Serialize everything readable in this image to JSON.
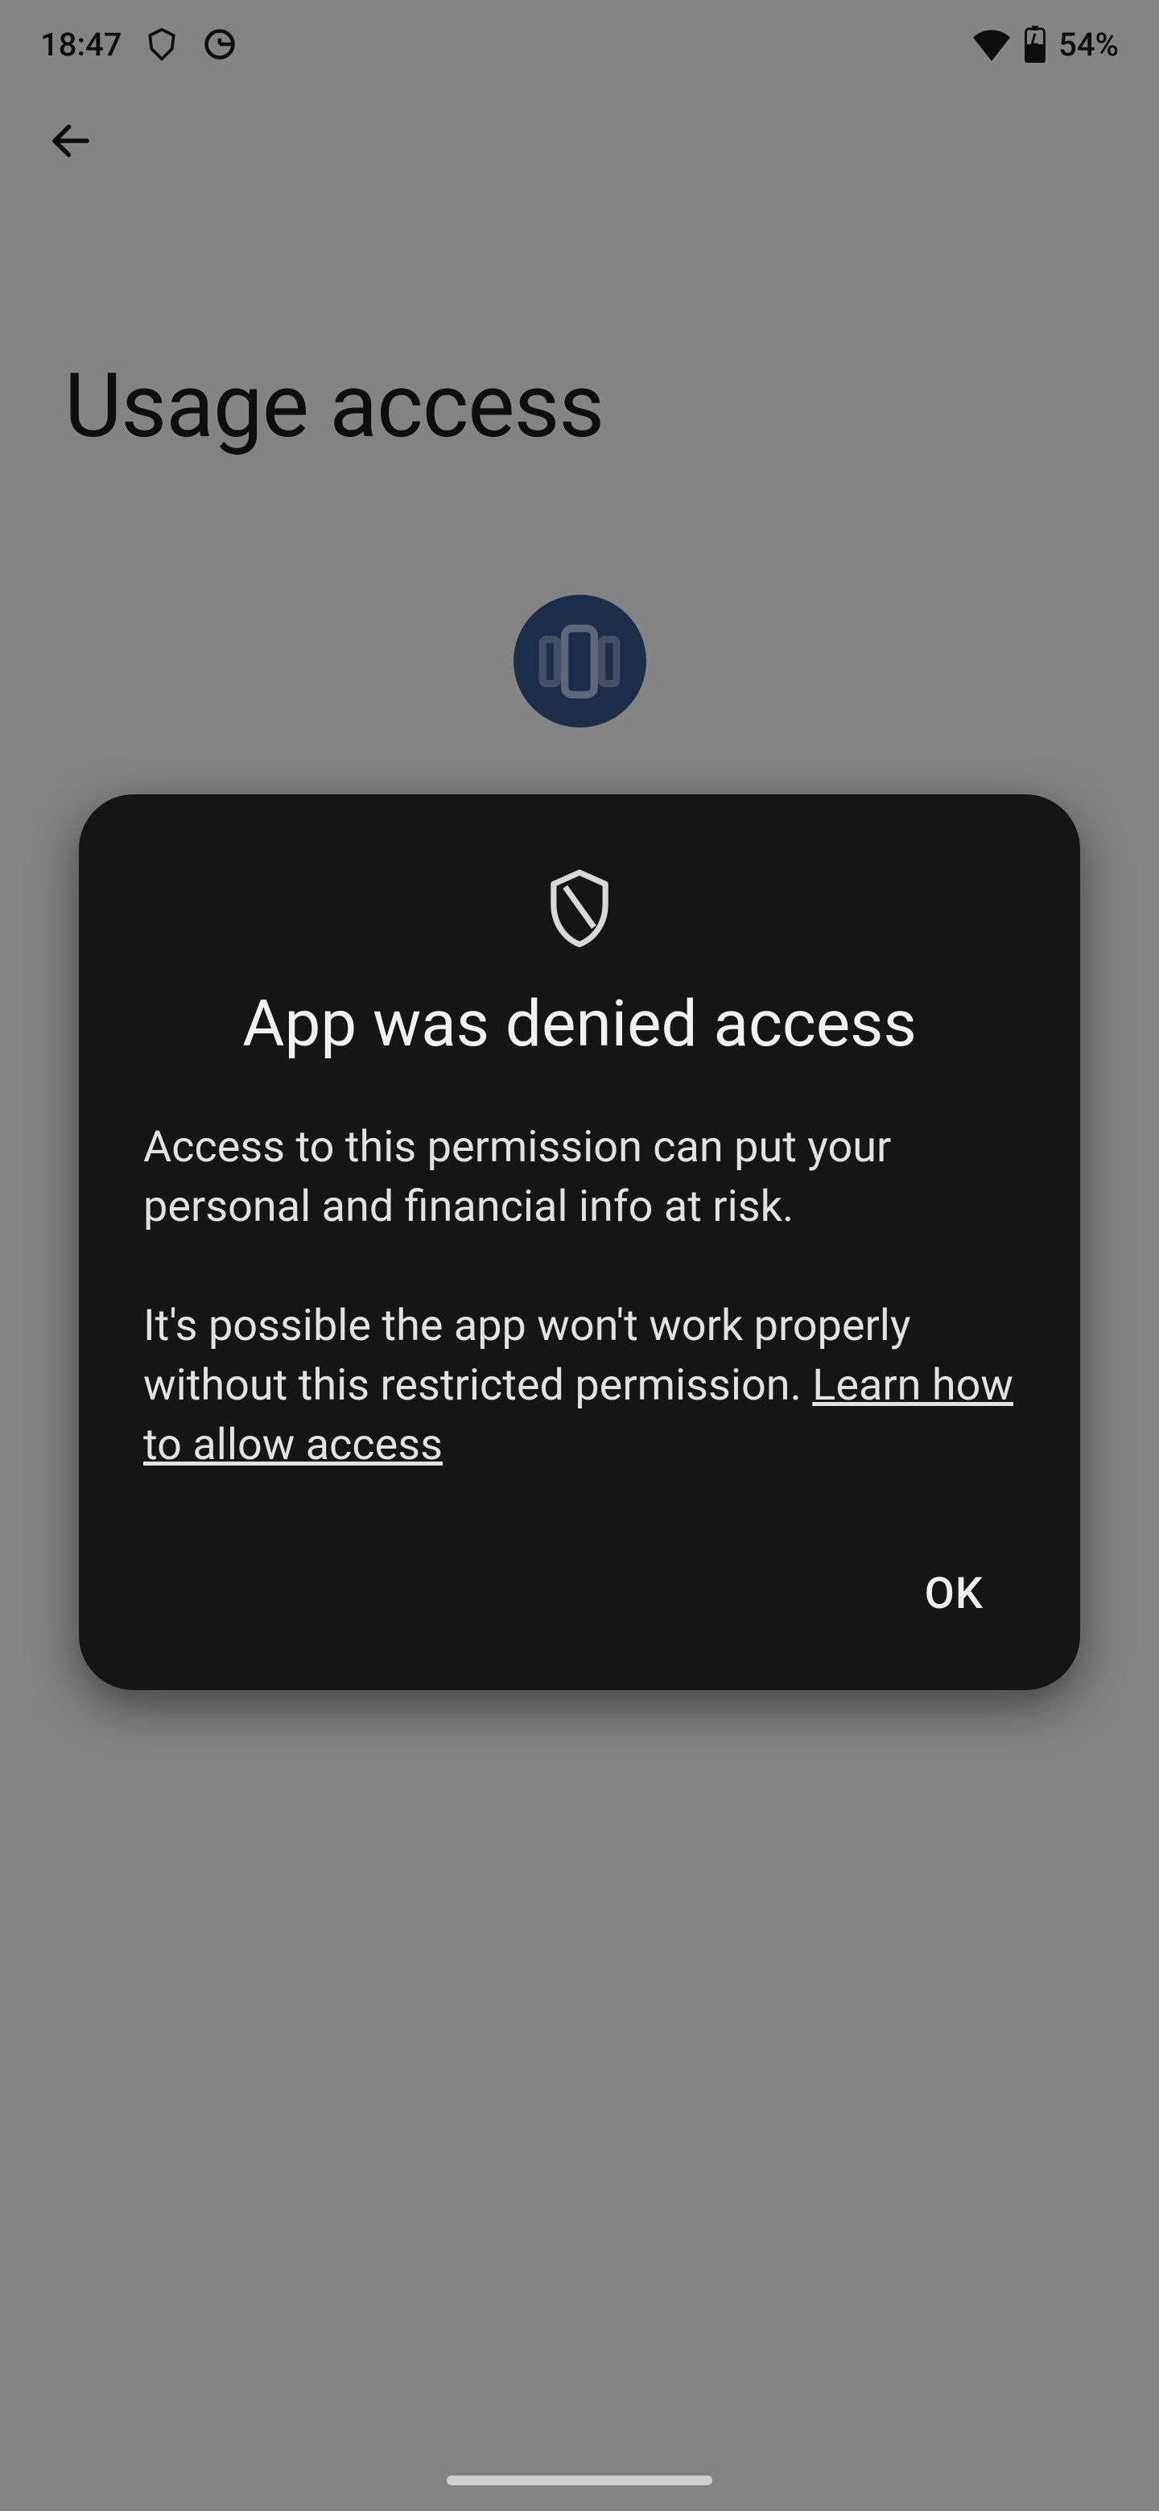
{
  "status_bar": {
    "time": "18:47",
    "battery_text": "54%"
  },
  "page": {
    "title": "Usage access"
  },
  "dialog": {
    "title": "App was denied access",
    "body_para1": "Access to this permission can put your personal and financial info at risk.",
    "body_para2_pre": "It's possible the app won't work properly without this restricted permission. ",
    "link_text": "Learn how to allow access",
    "ok_label": "OK"
  }
}
